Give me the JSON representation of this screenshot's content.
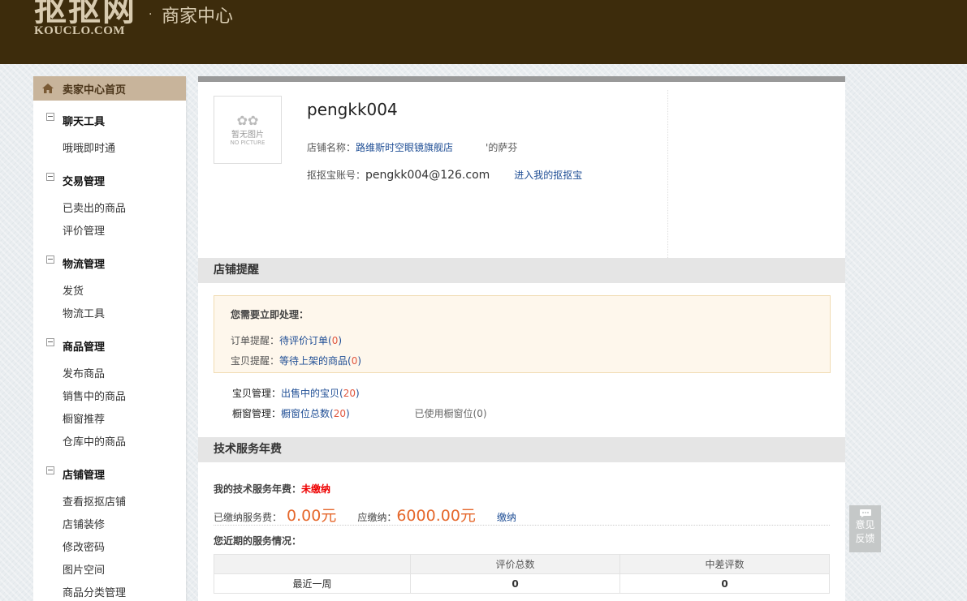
{
  "header": {
    "logo_cn": "抠抠网",
    "logo_en": "KOUCLO.COM",
    "dot": "·",
    "subtitle": "商家中心",
    "bg_color": "#3d2c0c"
  },
  "sidebar": {
    "home_label": "卖家中心首页",
    "groups": [
      {
        "title": "聊天工具",
        "items": [
          "哦哦即时通"
        ]
      },
      {
        "title": "交易管理",
        "items": [
          "已卖出的商品",
          "评价管理"
        ]
      },
      {
        "title": "物流管理",
        "items": [
          "发货",
          "物流工具"
        ]
      },
      {
        "title": "商品管理",
        "items": [
          "发布商品",
          "销售中的商品",
          "橱窗推荐",
          "仓库中的商品"
        ]
      },
      {
        "title": "店铺管理",
        "items": [
          "查看抠抠店铺",
          "店铺装修",
          "修改密码",
          "图片空间",
          "商品分类管理"
        ]
      }
    ]
  },
  "profile": {
    "avatar_text": "暂无图片",
    "avatar_sub": "NO PICTURE",
    "username": "pengkk004",
    "shop_label": "店铺名称：",
    "shop_name": "路维斯时空眼镜旗舰店",
    "shop_extra": "'的萨芬",
    "account_label": "抠抠宝账号：",
    "account_value": "pengkk004@126.com",
    "enter_link": "进入我的抠抠宝"
  },
  "reminder": {
    "section_title": "店铺提醒",
    "alert_title": "您需要立即处理：",
    "order_label": "订单提醒：",
    "order_link": "待评价订单",
    "order_count": "0",
    "item_label": "宝贝提醒：",
    "item_link": "等待上架的商品",
    "item_count": "0",
    "goods_label": "宝贝管理：",
    "goods_link": "出售中的宝贝",
    "goods_count": "20",
    "window_label": "橱窗管理：",
    "window_link": "橱窗位总数",
    "window_count": "20",
    "window_used_label": "已使用橱窗位",
    "window_used_count": "0"
  },
  "fee": {
    "section_title": "技术服务年费",
    "status_label": "我的技术服务年费：",
    "status_value": "未缴纳",
    "paid_label": "已缴纳服务费：",
    "paid_value": "0.00元",
    "due_label": "应缴纳：",
    "due_value": "6000.00元",
    "pay_link": "缴纳",
    "recent_label": "您近期的服务情况：",
    "table": {
      "headers": [
        "",
        "评价总数",
        "中差评数"
      ],
      "rows": [
        [
          "最近一周",
          "0",
          "0"
        ]
      ]
    }
  },
  "feedback": {
    "line1": "意见",
    "line2": "反馈"
  }
}
